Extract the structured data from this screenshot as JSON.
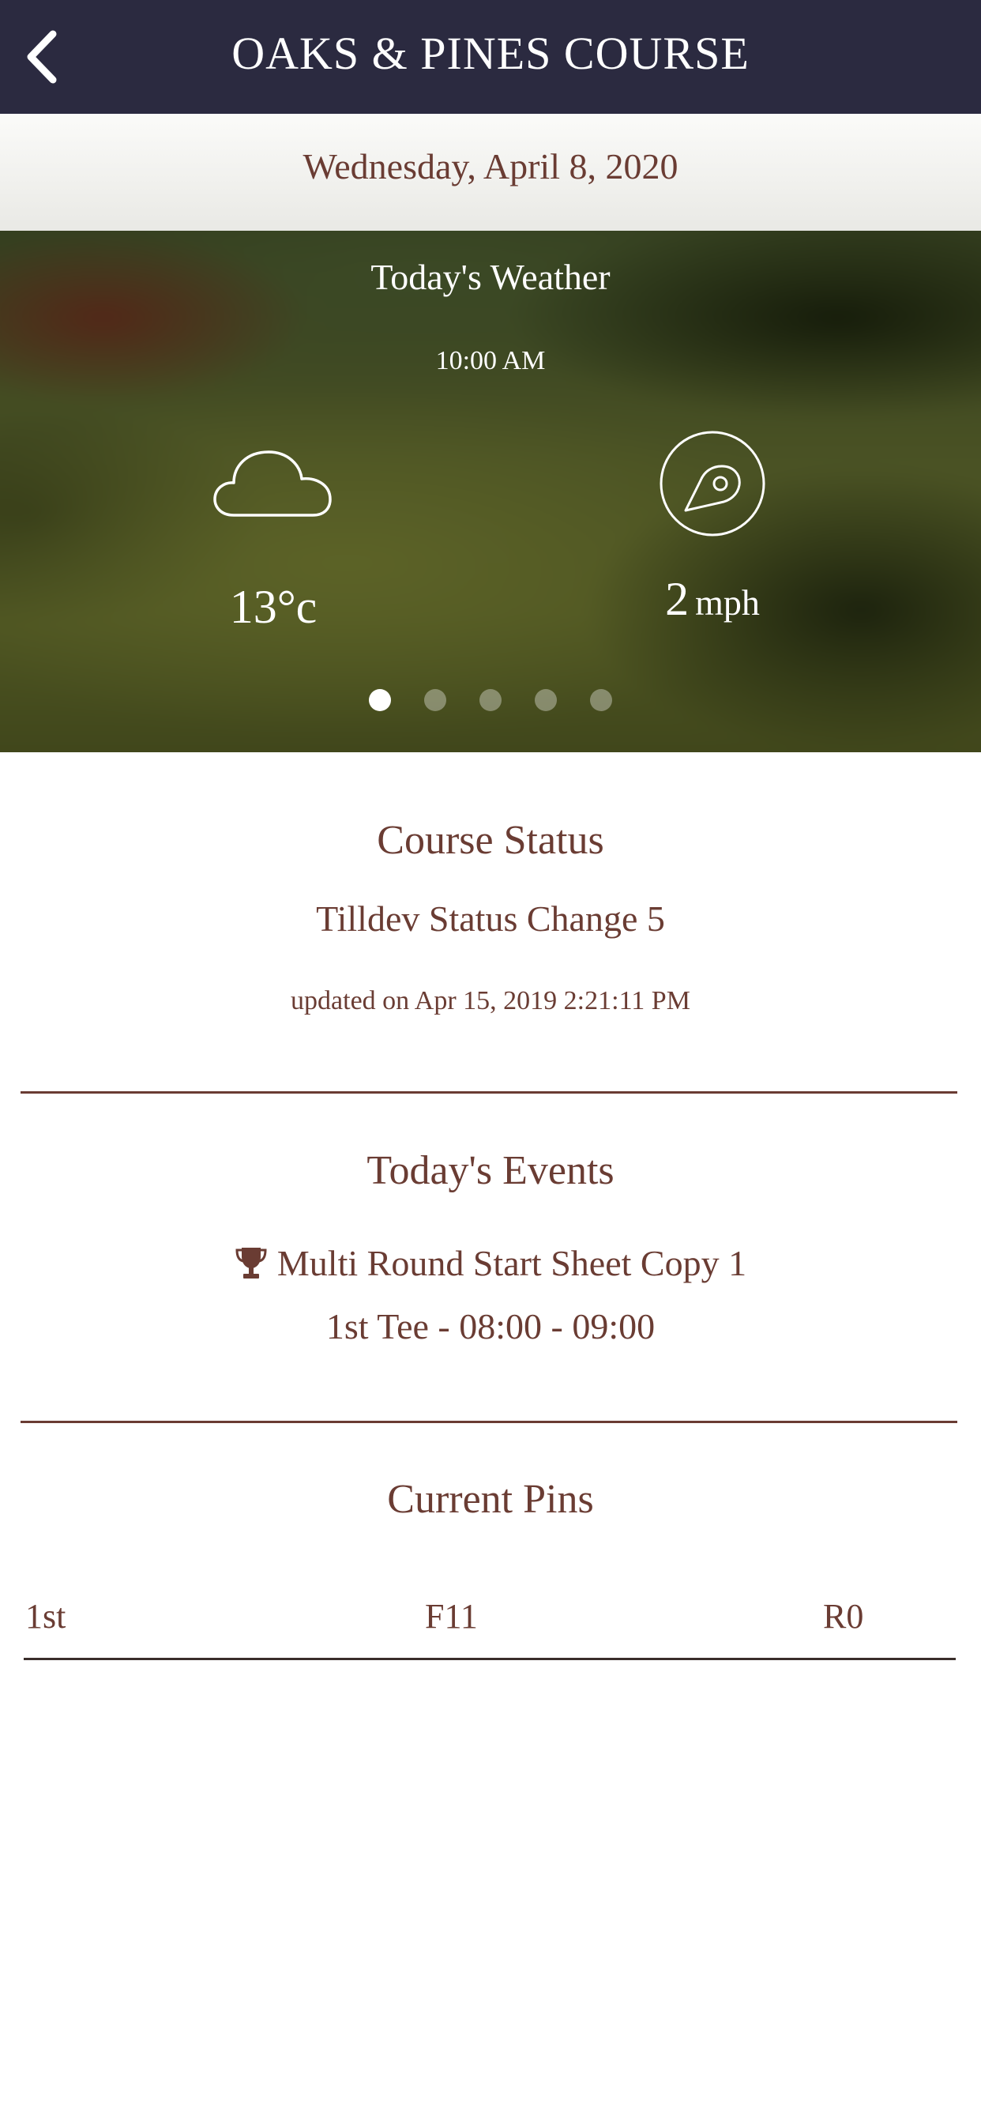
{
  "header": {
    "title": "OAKS & PINES COURSE",
    "back_icon": "chevron-left-icon",
    "background": "#2b2a40"
  },
  "date_band": {
    "date": "Wednesday, April 8, 2020"
  },
  "weather": {
    "title": "Today's Weather",
    "time": "10:00 AM",
    "temperature": "13°c",
    "wind_speed": "2",
    "wind_unit": "mph",
    "condition_icon": "cloud-icon",
    "wind_icon": "wind-direction-icon",
    "pager": {
      "pages": 5,
      "active_index": 0
    }
  },
  "course_status": {
    "title": "Course Status",
    "status": "Tilldev Status Change 5",
    "updated": "updated on Apr 15, 2019 2:21:11 PM"
  },
  "events": {
    "title": "Today's Events",
    "items": [
      {
        "icon": "trophy-icon",
        "name": "Multi Round Start Sheet Copy 1",
        "detail": "1st Tee - 08:00 - 09:00"
      }
    ]
  },
  "pins": {
    "title": "Current Pins",
    "rows": [
      {
        "hole": "1st",
        "front": "F11",
        "right": "R0"
      }
    ]
  },
  "colors": {
    "accent_text": "#6a3c33",
    "header_bg": "#2b2a40"
  }
}
